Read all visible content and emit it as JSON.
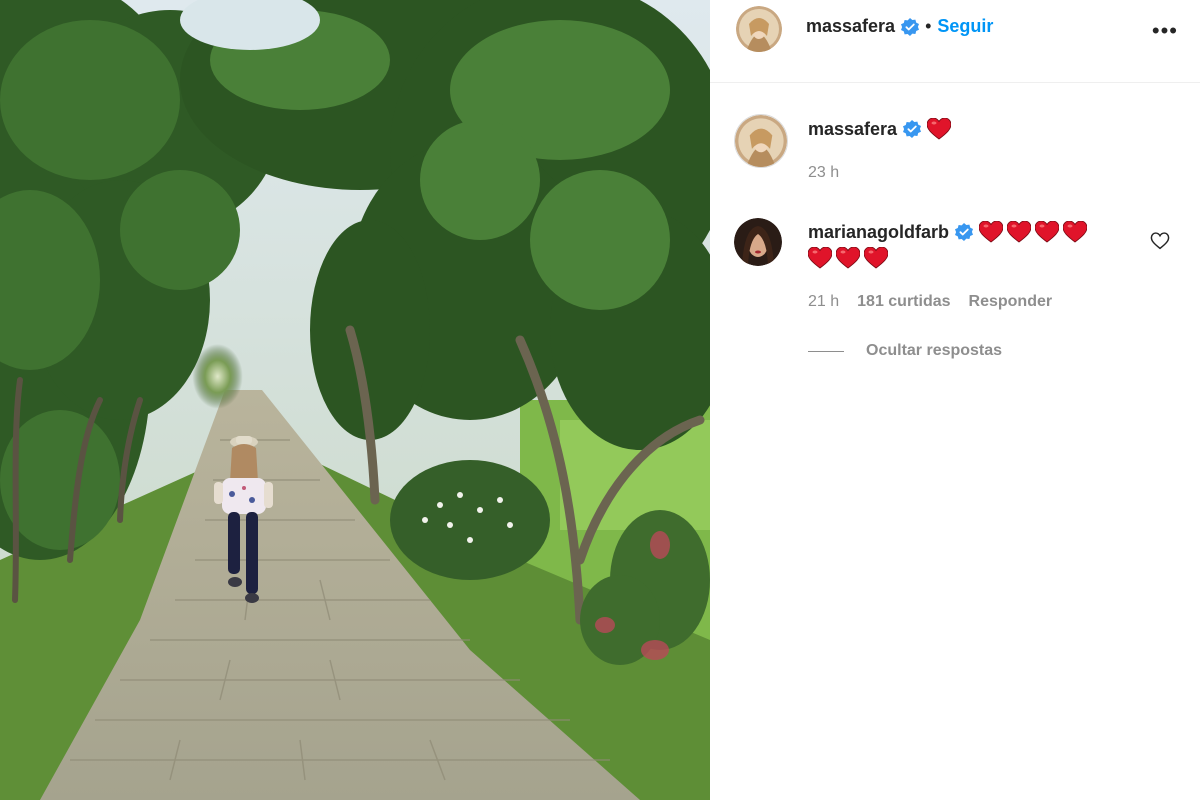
{
  "post": {
    "author": "massafera",
    "follow_label": "Seguir",
    "separator": "•",
    "more_label": "•••"
  },
  "comments": [
    {
      "username": "massafera",
      "verified": true,
      "emoji": "heart",
      "emoji_count": 1,
      "time": "23 h"
    },
    {
      "username": "marianagoldfarb",
      "verified": true,
      "emoji": "heart",
      "emoji_count_line1": 4,
      "emoji_count_line2": 3,
      "time": "21 h",
      "likes": "181 curtidas",
      "reply_label": "Responder",
      "hide_replies_label": "Ocultar respostas"
    }
  ],
  "colors": {
    "accent": "#0095f6",
    "verified_badge": "#3897f0",
    "heart": "#e0142a",
    "secondary_text": "#8e8e8e"
  }
}
